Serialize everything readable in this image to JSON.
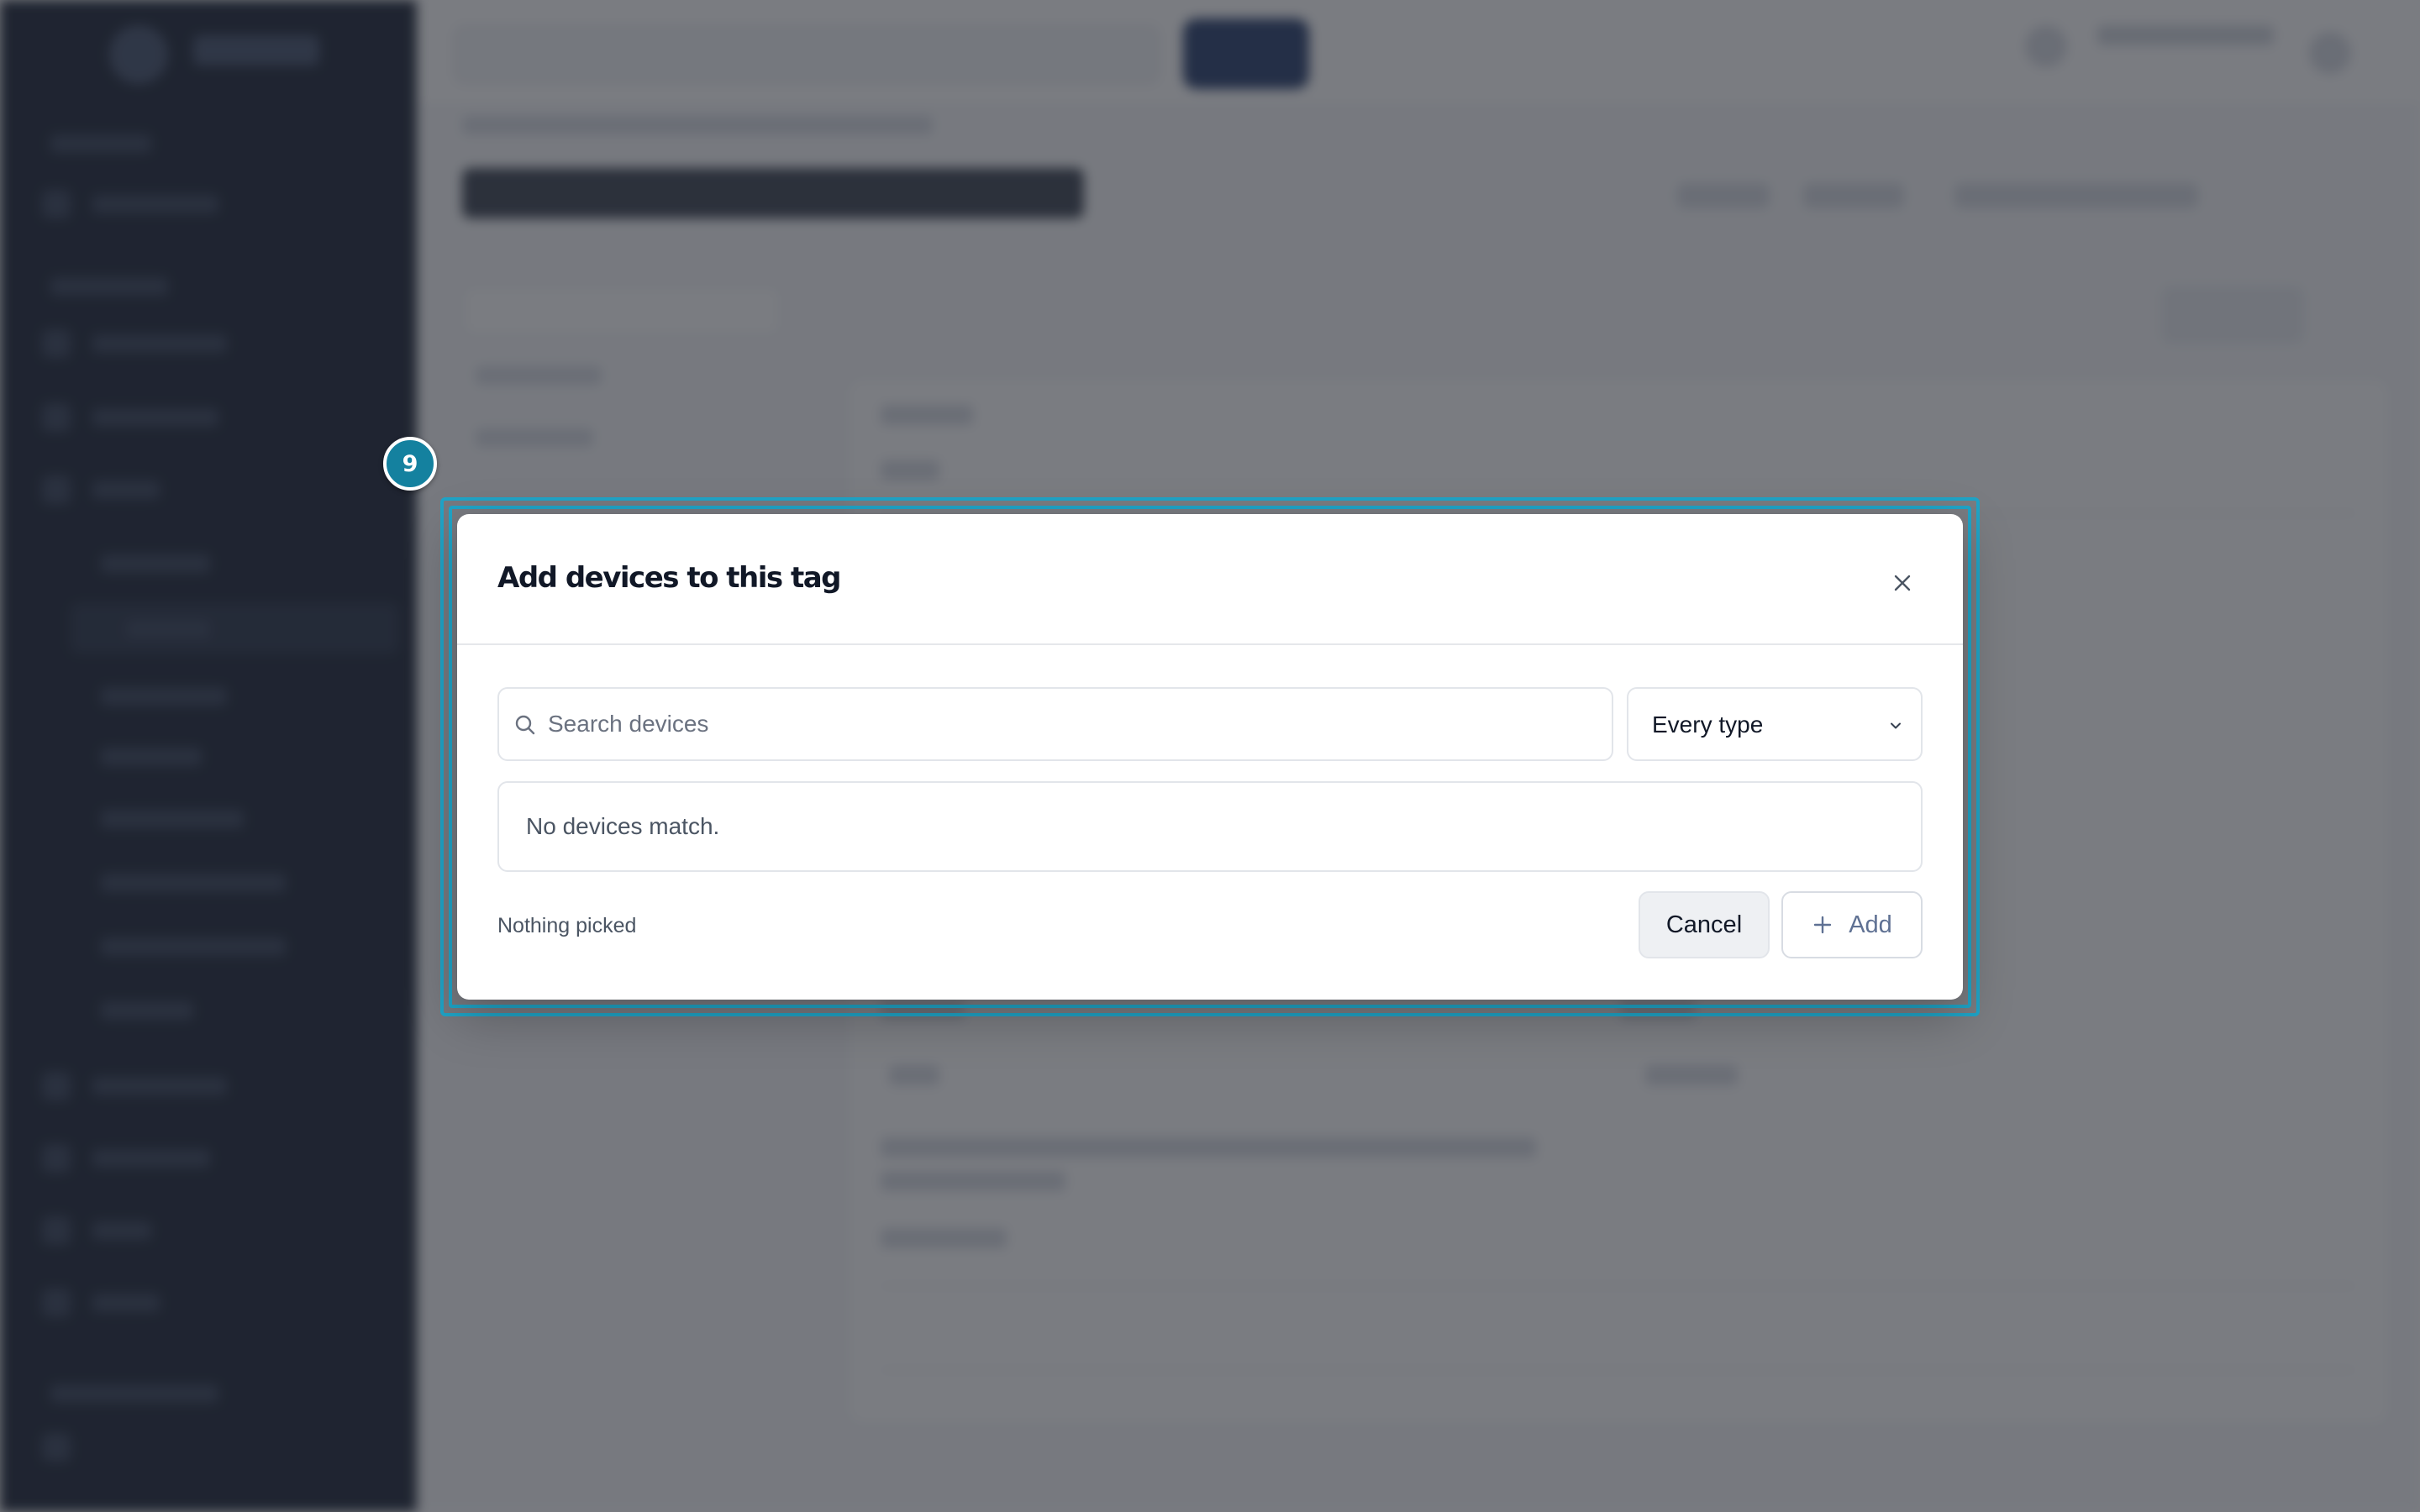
{
  "step": {
    "number": "9"
  },
  "modal": {
    "title": "Add devices to this tag",
    "search": {
      "placeholder": "Search devices",
      "value": ""
    },
    "type_filter": {
      "selected": "Every type"
    },
    "empty_message": "No devices match.",
    "selection_status": "Nothing picked",
    "cancel_label": "Cancel",
    "add_label": "Add"
  },
  "icons": {
    "close": "close-icon",
    "search": "search-icon",
    "chevron": "chevron-down-icon",
    "plus": "plus-icon"
  },
  "colors": {
    "highlight": "#1fa4c7",
    "badge": "#14819f",
    "sidebar": "#111a2d",
    "title_text": "#111827",
    "add_text": "#5f7193"
  }
}
